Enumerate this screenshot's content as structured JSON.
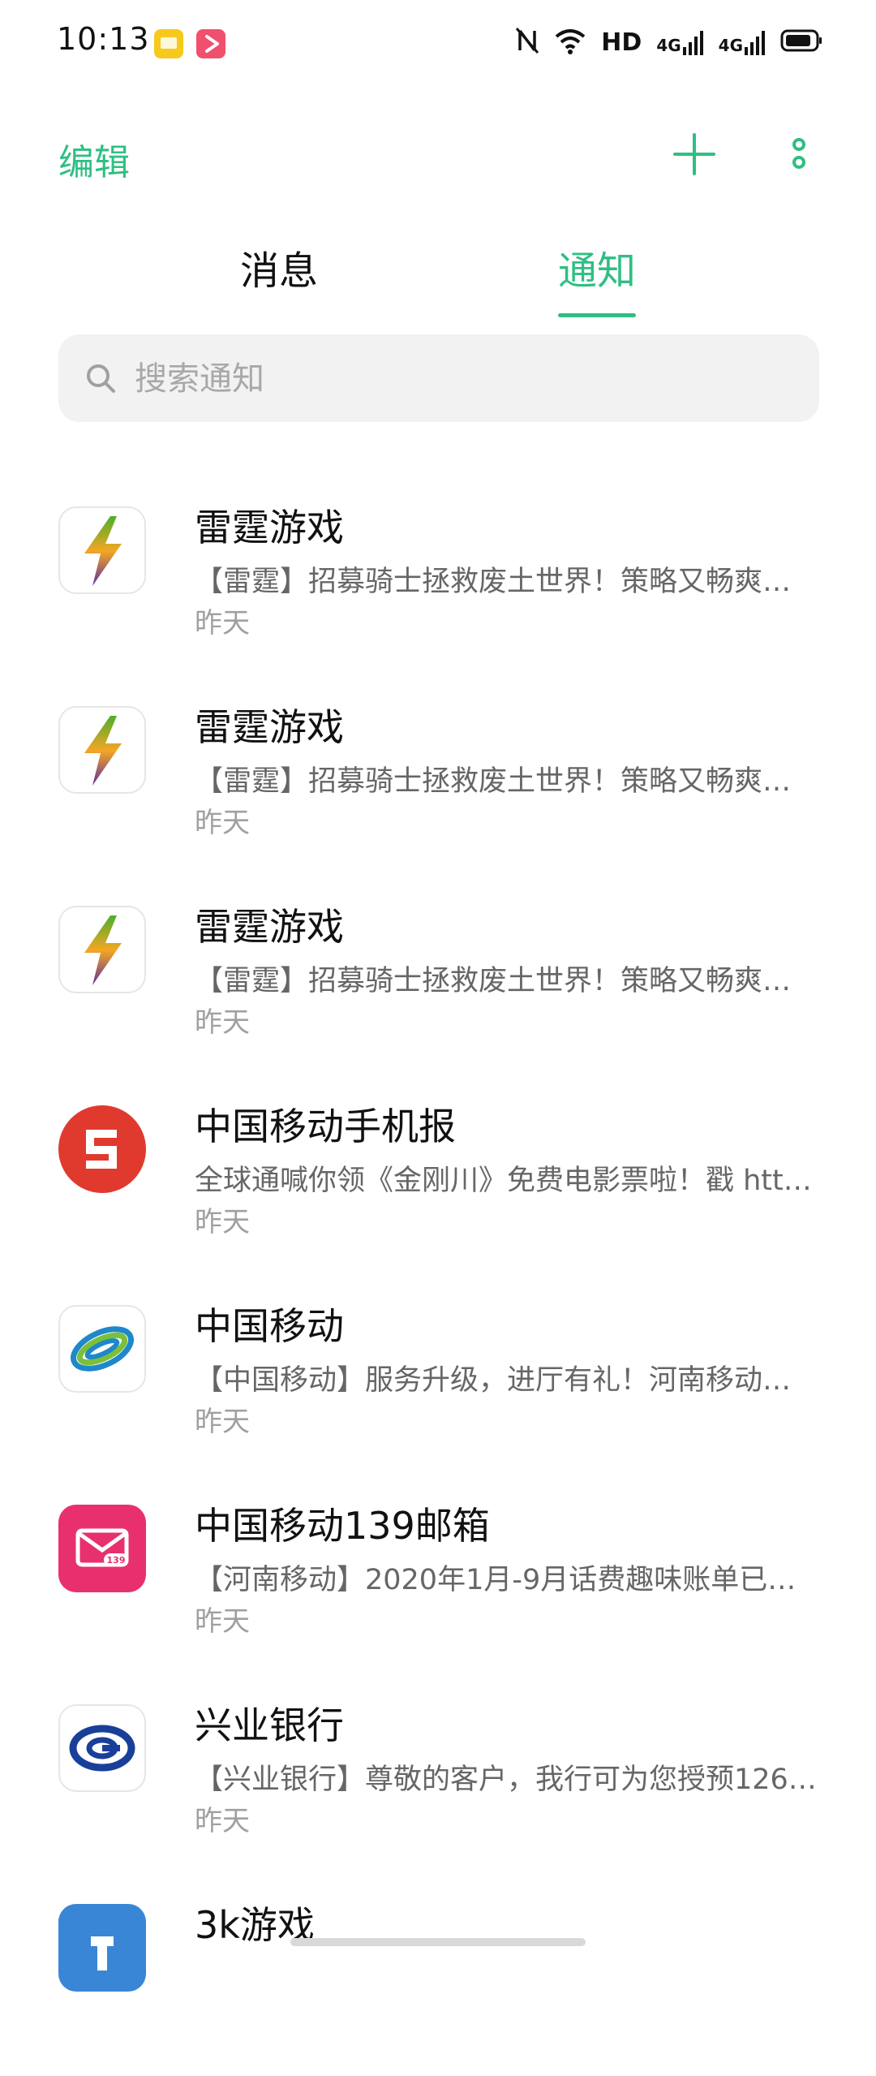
{
  "status_bar": {
    "time": "10:13",
    "hd": "HD",
    "net1": "4G",
    "net2": "4G"
  },
  "colors": {
    "accent": "#2fbf82",
    "text_primary": "#111111",
    "text_secondary": "#666666",
    "text_muted": "#a0a0a0"
  },
  "header": {
    "edit_label": "编辑",
    "add_icon": "plus-icon",
    "more_icon": "more-vertical-icon"
  },
  "tabs": [
    {
      "label": "消息",
      "active": false
    },
    {
      "label": "通知",
      "active": true
    }
  ],
  "search": {
    "placeholder": "搜索通知"
  },
  "notifications": [
    {
      "title": "雷霆游戏",
      "preview": "【雷霆】招募骑士拯救废土世界！策略又畅爽…",
      "time": "昨天",
      "icon": "thunder-game-icon"
    },
    {
      "title": "雷霆游戏",
      "preview": "【雷霆】招募骑士拯救废土世界！策略又畅爽…",
      "time": "昨天",
      "icon": "thunder-game-icon"
    },
    {
      "title": "雷霆游戏",
      "preview": "【雷霆】招募骑士拯救废土世界！策略又畅爽…",
      "time": "昨天",
      "icon": "thunder-game-icon"
    },
    {
      "title": "中国移动手机报",
      "preview": "全球通喊你领《金刚川》免费电影票啦！戳 htt…",
      "time": "昨天",
      "icon": "mobile-newspaper-icon"
    },
    {
      "title": "中国移动",
      "preview": "【中国移动】服务升级，进厅有礼！河南移动…",
      "time": "昨天",
      "icon": "china-mobile-icon"
    },
    {
      "title": "中国移动139邮箱",
      "preview": "【河南移动】2020年1月-9月话费趣味账单已送…",
      "time": "昨天",
      "icon": "mail-139-icon"
    },
    {
      "title": "兴业银行",
      "preview": "【兴业银行】尊敬的客户，我行可为您授预126…",
      "time": "昨天",
      "icon": "industrial-bank-icon"
    },
    {
      "title": "3k游戏",
      "preview": "",
      "time": "",
      "icon": "3k-game-icon"
    }
  ]
}
